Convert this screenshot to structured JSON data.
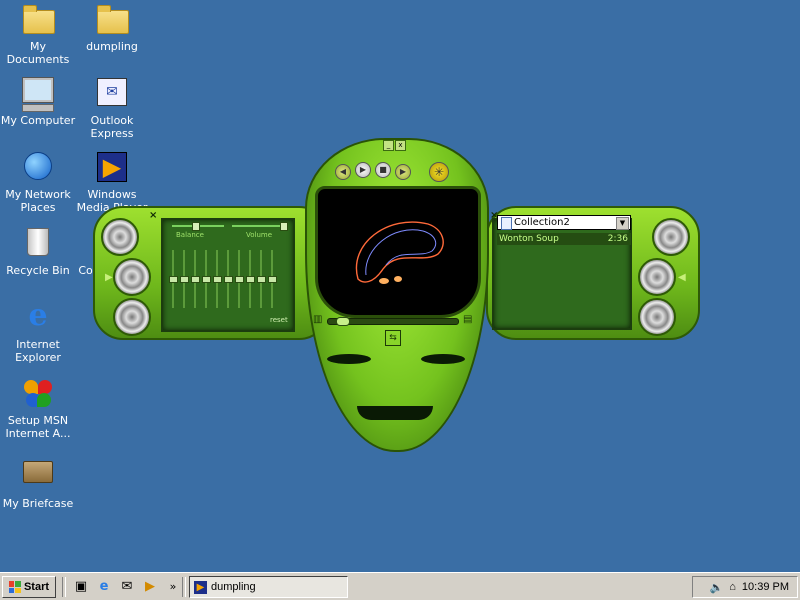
{
  "desktop": {
    "icons": [
      {
        "label": "My Documents"
      },
      {
        "label": "dumpling"
      },
      {
        "label": "My Computer"
      },
      {
        "label": "Outlook Express"
      },
      {
        "label": "My Network Places"
      },
      {
        "label": "Windows Media Player"
      },
      {
        "label": "Recycle Bin"
      },
      {
        "label": "Conn... Int..."
      },
      {
        "label": "Internet Explorer"
      },
      {
        "label": "Setup MSN Internet A..."
      },
      {
        "label": "My Briefcase"
      }
    ]
  },
  "player": {
    "title": "dumpling",
    "eq": {
      "balance_label": "Balance",
      "volume_label": "Volume",
      "reset_label": "reset",
      "band_levels": [
        0.5,
        0.5,
        0.5,
        0.5,
        0.5,
        0.5,
        0.5,
        0.5,
        0.5,
        0.5
      ]
    },
    "playlist": {
      "selected": "Collection2",
      "items": [
        {
          "title": "Wonton Soup",
          "duration": "2:36"
        }
      ]
    }
  },
  "taskbar": {
    "start_label": "Start",
    "chevron": "»",
    "task_title": "dumpling",
    "clock": "10:39 PM"
  },
  "colors": {
    "desktop": "#3a6ea5",
    "skin_green": "#7ccc21",
    "panel": "#2f6a1d"
  }
}
